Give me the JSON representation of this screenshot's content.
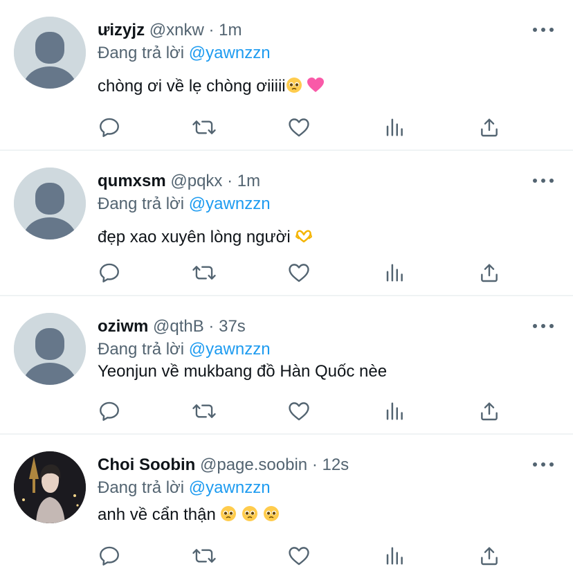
{
  "reply_prefix": "Đang trả lời",
  "separator": "·",
  "tweets": [
    {
      "name": "ưizyjz",
      "handle": "@xnkw",
      "time": "1m",
      "reply_to": "@yawnzzn",
      "text": "chòng ơi về lẹ chòng ơiiiii",
      "emojis": [
        "pleading-face",
        "pink-heart"
      ],
      "avatar": "default"
    },
    {
      "name": "qumxsm",
      "handle": "@pqkx",
      "time": "1m",
      "reply_to": "@yawnzzn",
      "text": "đẹp xao xuyên lòng người",
      "emojis": [
        "heart-hands"
      ],
      "avatar": "default"
    },
    {
      "name": "oziwm",
      "handle": "@qthB",
      "time": "37s",
      "reply_to": "@yawnzzn",
      "text": "Yeonjun về mukbang đồ Hàn Quốc nèe",
      "emojis": [],
      "avatar": "default"
    },
    {
      "name": "Choi Soobin",
      "handle": "@page.soobin",
      "time": "12s",
      "reply_to": "@yawnzzn",
      "text": "anh về cẩn thận",
      "emojis": [
        "pleading-face",
        "pleading-face",
        "pleading-face"
      ],
      "avatar": "photo"
    }
  ],
  "icons": {
    "reply": "reply-icon",
    "retweet": "retweet-icon",
    "like": "heart-icon",
    "views": "views-icon",
    "share": "share-icon",
    "more": "more-icon"
  },
  "colors": {
    "text": "#0f1419",
    "secondary": "#536471",
    "mention": "#1d9bf0",
    "divider": "#eff3f4",
    "avatar_bg": "#cfd9de",
    "avatar_fg": "#66778a"
  }
}
